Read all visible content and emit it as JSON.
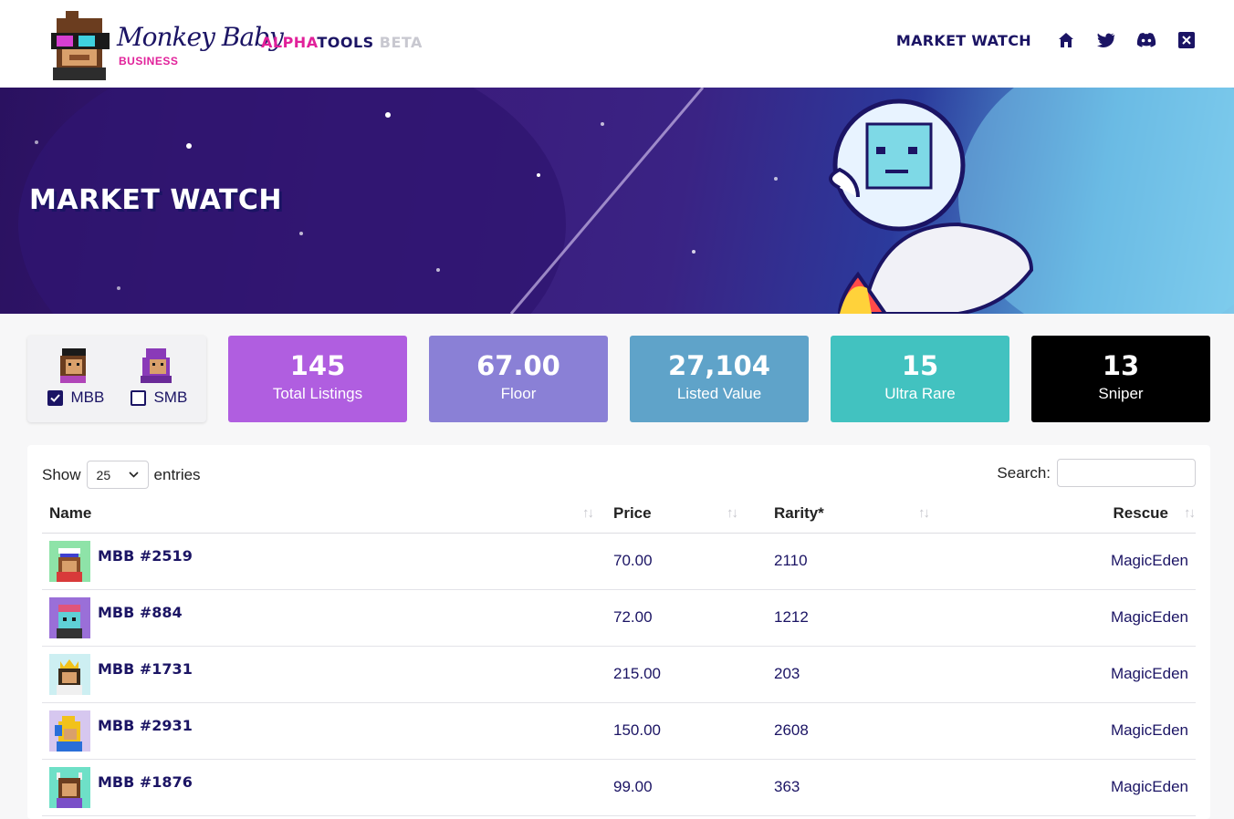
{
  "brand": {
    "logo_text": "Monkey Baby",
    "logo_sub": "BUSINESS",
    "alpha": "ALPHA",
    "tools": "TOOLS",
    "beta": " BETA"
  },
  "nav": {
    "market_watch": "MARKET WATCH",
    "icons": [
      "home-icon",
      "twitter-icon",
      "discord-icon",
      "x-icon"
    ]
  },
  "hero": {
    "title": "MARKET WATCH"
  },
  "filters": {
    "mbb": {
      "label": "MBB",
      "checked": true
    },
    "smb": {
      "label": "SMB",
      "checked": false
    }
  },
  "stats": [
    {
      "value": "145",
      "label": "Total Listings",
      "color": "#b05ee0"
    },
    {
      "value": "67.00",
      "label": "Floor",
      "color": "#8a80d6"
    },
    {
      "value": "27,104",
      "label": "Listed Value",
      "color": "#5fa3c9"
    },
    {
      "value": "15",
      "label": "Ultra Rare",
      "color": "#42c2c0"
    },
    {
      "value": "13",
      "label": "Sniper",
      "color": "#000000"
    }
  ],
  "table_controls": {
    "show": "Show",
    "entries_value": "25",
    "entries": "entries",
    "search": "Search:"
  },
  "columns": [
    "Name",
    "Price",
    "Rarity*",
    "Rescue"
  ],
  "rows": [
    {
      "name": "MBB #2519",
      "price": "70.00",
      "rarity": "2110",
      "rescue": "MagicEden",
      "bg": "#8ee3a8"
    },
    {
      "name": "MBB #884",
      "price": "72.00",
      "rarity": "1212",
      "rescue": "MagicEden",
      "bg": "#9a6fd8"
    },
    {
      "name": "MBB #1731",
      "price": "215.00",
      "rarity": "203",
      "rescue": "MagicEden",
      "bg": "#cdeff2"
    },
    {
      "name": "MBB #2931",
      "price": "150.00",
      "rarity": "2608",
      "rescue": "MagicEden",
      "bg": "#d6c7ef"
    },
    {
      "name": "MBB #1876",
      "price": "99.00",
      "rarity": "363",
      "rescue": "MagicEden",
      "bg": "#6ee0c7"
    }
  ]
}
